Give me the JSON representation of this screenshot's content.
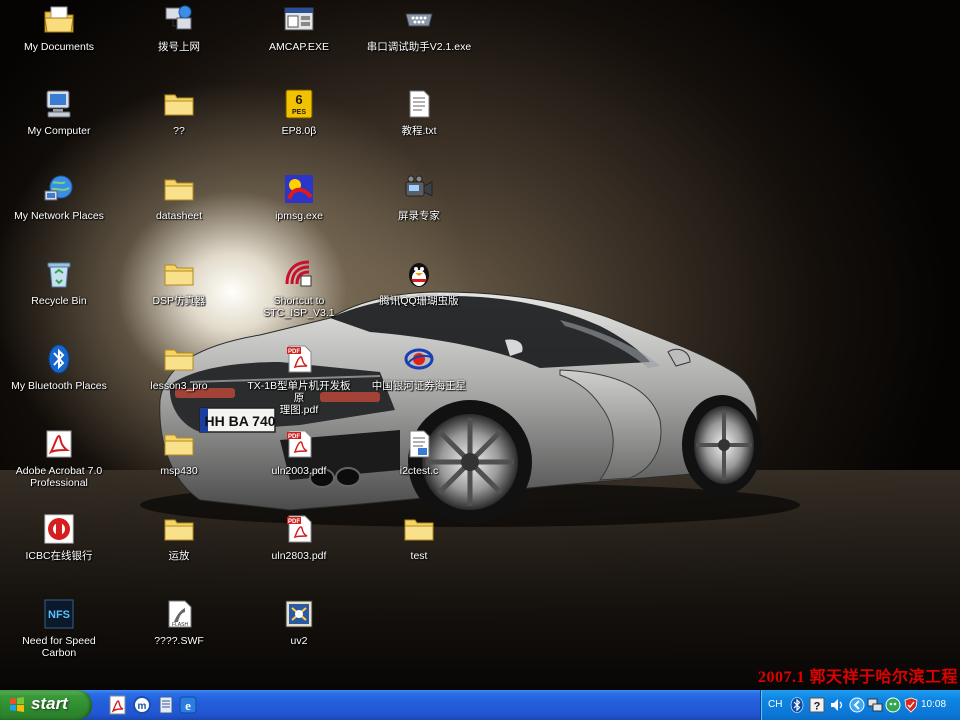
{
  "desktop": {
    "icons": [
      {
        "label": "My Documents"
      },
      {
        "label": "My Computer"
      },
      {
        "label": "My Network Places"
      },
      {
        "label": "Recycle Bin"
      },
      {
        "label": "My Bluetooth Places"
      },
      {
        "label": "Adobe Acrobat 7.0\nProfessional"
      },
      {
        "label": "ICBC在线银行"
      },
      {
        "label": "Need for Speed Carbon"
      },
      {
        "label": "拨号上网"
      },
      {
        "label": "??"
      },
      {
        "label": "datasheet"
      },
      {
        "label": "DSP仿真器"
      },
      {
        "label": "lesson3_pro"
      },
      {
        "label": "msp430"
      },
      {
        "label": "运放"
      },
      {
        "label": "????.SWF"
      },
      {
        "label": "AMCAP.EXE"
      },
      {
        "label": "EP8.0β"
      },
      {
        "label": "ipmsg.exe"
      },
      {
        "label": "Shortcut to\nSTC_ISP_V3.1"
      },
      {
        "label": "TX-1B型单片机开发板原\n理图.pdf"
      },
      {
        "label": "uln2003.pdf"
      },
      {
        "label": "uln2803.pdf"
      },
      {
        "label": "uv2"
      },
      {
        "label": "串口调试助手V2.1.exe"
      },
      {
        "label": "教程.txt"
      },
      {
        "label": "屏录专家"
      },
      {
        "label": "腾讯QQ珊瑚虫版"
      },
      {
        "label": "中国银河证券海王星"
      },
      {
        "label": "i2ctest.c"
      },
      {
        "label": "test"
      }
    ],
    "watermark": "2007.1 郭天祥于哈尔滨工程"
  },
  "wallpaper": {
    "plate": "HH BA 740"
  },
  "taskbar": {
    "start_label": "start",
    "language": "CH",
    "clock": "10:08"
  },
  "colors": {
    "taskbar_blue": "#245edb",
    "start_green": "#3a9a3a",
    "tray_blue": "#0c77d6",
    "watermark_red": "#e00000",
    "folder_yellow": "#f5d56a"
  }
}
